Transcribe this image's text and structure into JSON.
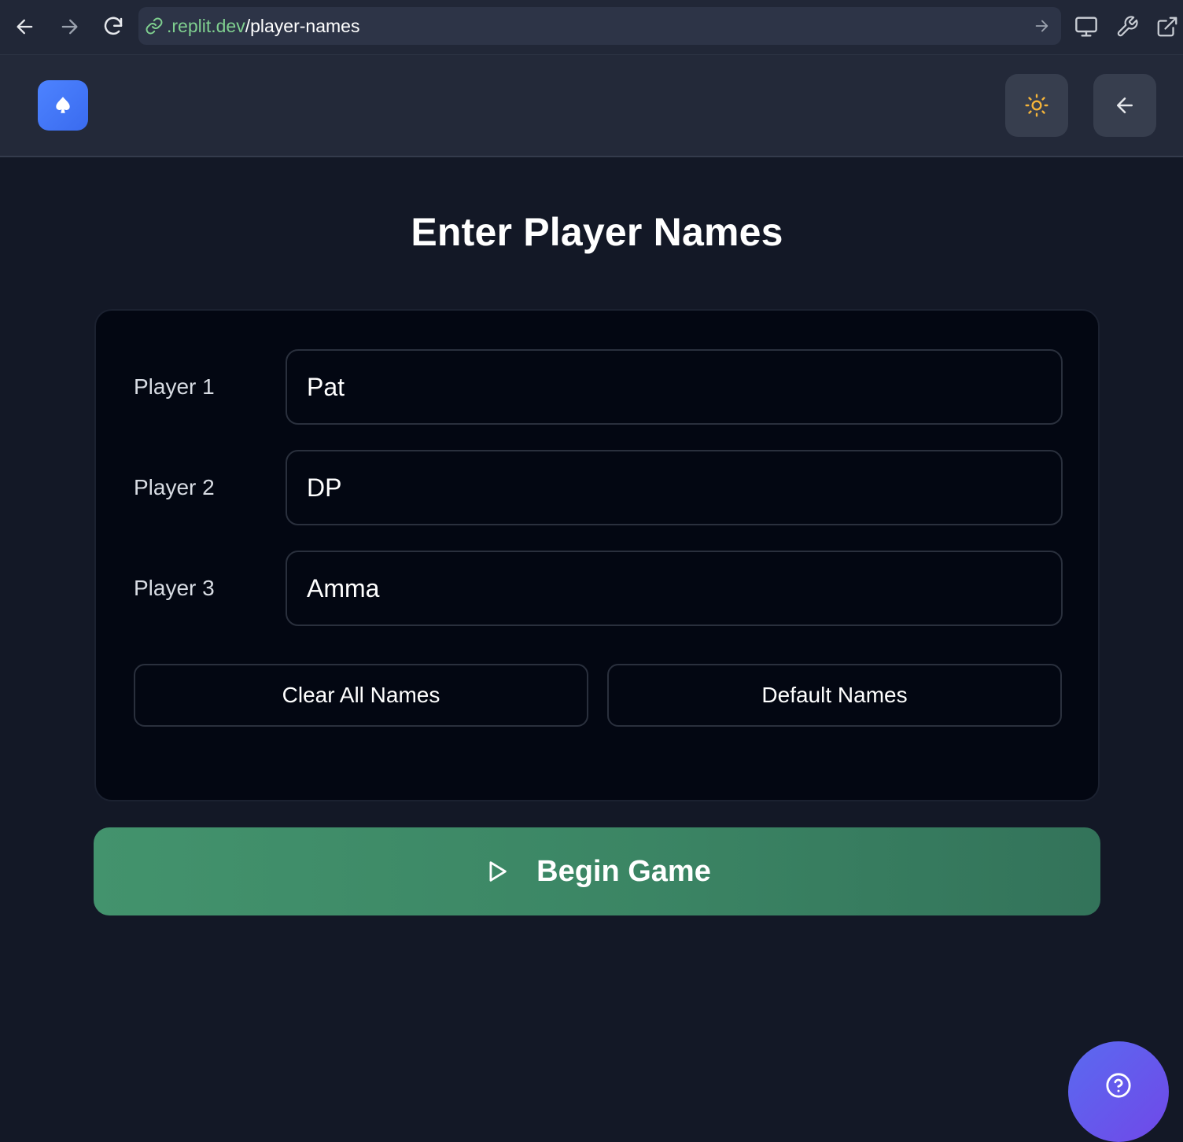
{
  "browser": {
    "url_domain": ".replit.dev",
    "url_path": "/player-names",
    "icons": [
      "back-arrow-icon",
      "forward-arrow-icon",
      "reload-icon",
      "link-icon",
      "go-arrow-icon",
      "monitor-icon",
      "wrench-icon",
      "external-link-icon"
    ]
  },
  "header": {
    "logo_icon": "spade-icon",
    "theme_icon": "sun-icon",
    "back_icon": "arrow-left-icon",
    "accent_color": "#3f76f7",
    "sun_color": "#f5b43a"
  },
  "main": {
    "title": "Enter Player Names",
    "players": [
      {
        "label": "Player 1",
        "value": "Pat"
      },
      {
        "label": "Player 2",
        "value": "DP"
      },
      {
        "label": "Player 3",
        "value": "Amma"
      }
    ],
    "clear_label": "Clear All Names",
    "default_label": "Default Names",
    "begin_label": "Begin Game",
    "begin_icon": "play-icon",
    "begin_color": "#3d8a66"
  },
  "help": {
    "icon": "help-circle-icon",
    "color": "#6356ec"
  }
}
